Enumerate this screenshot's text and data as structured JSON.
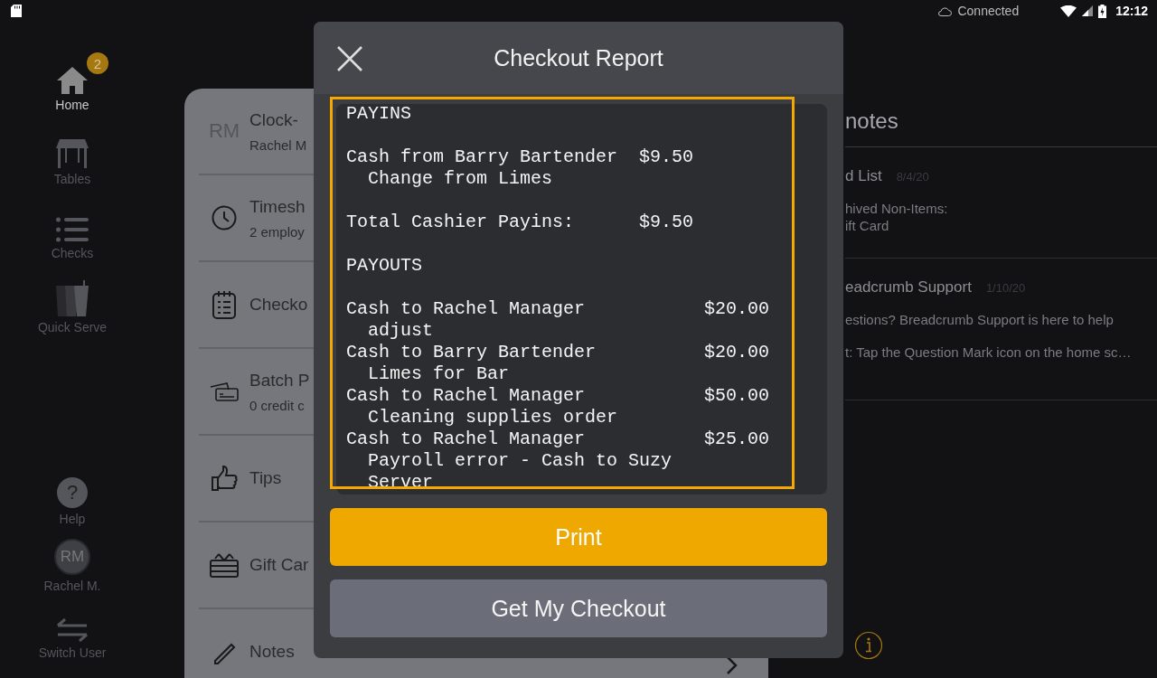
{
  "status_bar": {
    "connection": "Connected",
    "time": "12:12"
  },
  "nav": {
    "items": [
      {
        "kind": "home",
        "label": "Home",
        "selected": true,
        "badge": "2"
      },
      {
        "kind": "tables",
        "label": "Tables",
        "selected": false
      },
      {
        "kind": "checks",
        "label": "Checks",
        "selected": false
      },
      {
        "kind": "quick",
        "label": "Quick Serve",
        "selected": false
      }
    ],
    "bottom": [
      {
        "kind": "help",
        "label": "Help",
        "glyph": "?"
      },
      {
        "kind": "avatar",
        "label": "Rachel M.",
        "glyph": "RM"
      },
      {
        "kind": "switch",
        "label": "Switch User"
      }
    ]
  },
  "card": {
    "rows": [
      {
        "kind": "initials",
        "initials": "RM",
        "title": "Clock-",
        "subtitle": "Rachel M"
      },
      {
        "kind": "clock",
        "title": "Timesh",
        "subtitle": "2 employ"
      },
      {
        "kind": "checklist",
        "title": "Checko"
      },
      {
        "kind": "cards",
        "title": "Batch P",
        "subtitle": "0 credit c"
      },
      {
        "kind": "thumb",
        "title": "Tips"
      },
      {
        "kind": "gift",
        "title": "Gift Car"
      },
      {
        "kind": "pencil",
        "title": "Notes"
      }
    ]
  },
  "notes": {
    "heading": "notes",
    "items": [
      {
        "title": "d List",
        "date": "8/4/20",
        "lines": [
          "hived Non-Items:",
          "ift Card"
        ]
      },
      {
        "title": "eadcrumb Support",
        "date": "1/10/20",
        "lines": [
          "estions? Breadcrumb Support is here to help",
          "t: Tap the Question Mark icon on the home sc…"
        ]
      }
    ]
  },
  "dialog": {
    "title": "Checkout Report",
    "report": {
      "sections": [
        {
          "kind": "payins",
          "heading": "PAYINS",
          "entries": [
            {
              "label": "Cash from Barry Bartender",
              "amount": "$9.50",
              "memo": "Change from Limes"
            }
          ],
          "total": {
            "label": "Total Cashier Payins:",
            "amount": "$9.50"
          }
        },
        {
          "kind": "payouts",
          "heading": "PAYOUTS",
          "entries": [
            {
              "label": "Cash to Rachel Manager",
              "amount": "$20.00",
              "memo": "adjust"
            },
            {
              "label": "Cash to Barry Bartender",
              "amount": "$20.00",
              "memo": "Limes for Bar"
            },
            {
              "label": "Cash to Rachel Manager",
              "amount": "$50.00",
              "memo": "Cleaning supplies order"
            },
            {
              "label": "Cash to Rachel Manager",
              "amount": "$25.00",
              "memo": "Payroll error - Cash to Suzy Server"
            }
          ]
        }
      ]
    },
    "buttons": [
      {
        "kind": "primary",
        "label": "Print"
      },
      {
        "kind": "secondary",
        "label": "Get My Checkout"
      }
    ]
  }
}
